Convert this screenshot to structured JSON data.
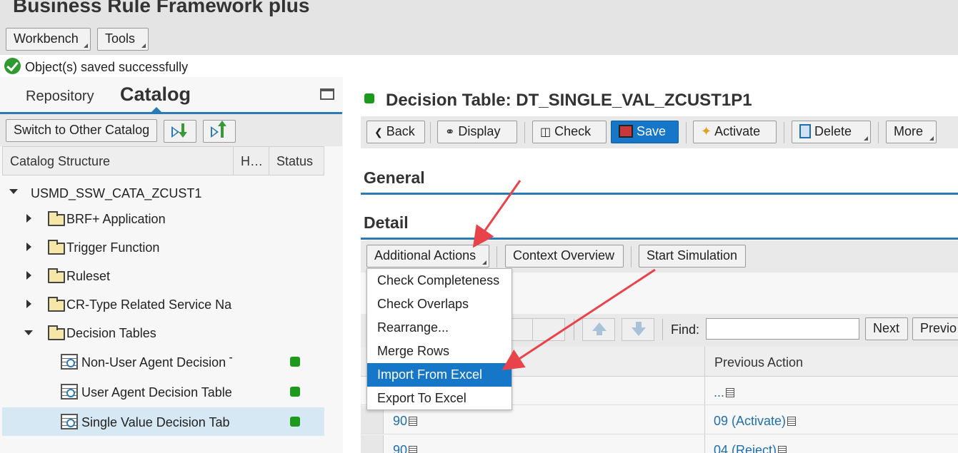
{
  "header": {
    "title": "Business Rule Framework plus",
    "menu_buttons": [
      "Workbench",
      "Tools"
    ]
  },
  "message": {
    "text": "Object(s) saved successfully",
    "type": "success"
  },
  "left_panel": {
    "tabs": {
      "repository": "Repository",
      "catalog": "Catalog",
      "active": "Catalog"
    },
    "toolbar": {
      "switch_label": "Switch to Other Catalog",
      "expand_icon": "expand-all-icon",
      "collapse_icon": "collapse-all-icon"
    },
    "columns": [
      "Catalog Structure",
      "H…",
      "Status"
    ],
    "tree": {
      "root": "USMD_SSW_CATA_ZCUST1",
      "items": [
        {
          "label": "BRF+ Application",
          "expanded": false
        },
        {
          "label": "Trigger Function",
          "expanded": false
        },
        {
          "label": "Ruleset",
          "expanded": false
        },
        {
          "label": "CR-Type Related Service Na",
          "expanded": false
        },
        {
          "label": "Decision Tables",
          "expanded": true
        }
      ],
      "children": [
        {
          "label": "Non-User Agent Decision T",
          "status": "active"
        },
        {
          "label": "User Agent Decision Table",
          "status": "active"
        },
        {
          "label": "Single Value Decision Tab",
          "status": "active",
          "selected": true
        }
      ]
    },
    "status_color": "#1d9a1d"
  },
  "object": {
    "title": "Decision Table: DT_SINGLE_VAL_ZCUST1P1",
    "status_color": "#1d9a1d"
  },
  "toolbar": {
    "back": "Back",
    "display": "Display",
    "check": "Check",
    "save": "Save",
    "activate": "Activate",
    "delete": "Delete",
    "more": "More"
  },
  "sections": {
    "general": "General",
    "detail": "Detail"
  },
  "detail_toolbar": {
    "additional_actions": "Additional Actions",
    "context_overview": "Context Overview",
    "start_simulation": "Start Simulation"
  },
  "menu": {
    "items": [
      "Check Completeness",
      "Check Overlaps",
      "Rearrange...",
      "Merge Rows",
      "Import From Excel",
      "Export To Excel"
    ],
    "active_index": 4
  },
  "find_bar": {
    "label": "Find:",
    "value": "",
    "next": "Next",
    "previous": "Previo"
  },
  "grid": {
    "columns": [
      "",
      "Previous Action"
    ],
    "rows": [
      {
        "col1": "",
        "col2": "..."
      },
      {
        "col1": "90",
        "col2": "09 (Activate)"
      },
      {
        "col1": "90",
        "col2": "04 (Reject)"
      }
    ]
  },
  "colors": {
    "accent": "#2a7ab5",
    "primary_button": "#1677c8",
    "annotation_arrow": "#e8434a",
    "success": "#2f9a2f"
  }
}
